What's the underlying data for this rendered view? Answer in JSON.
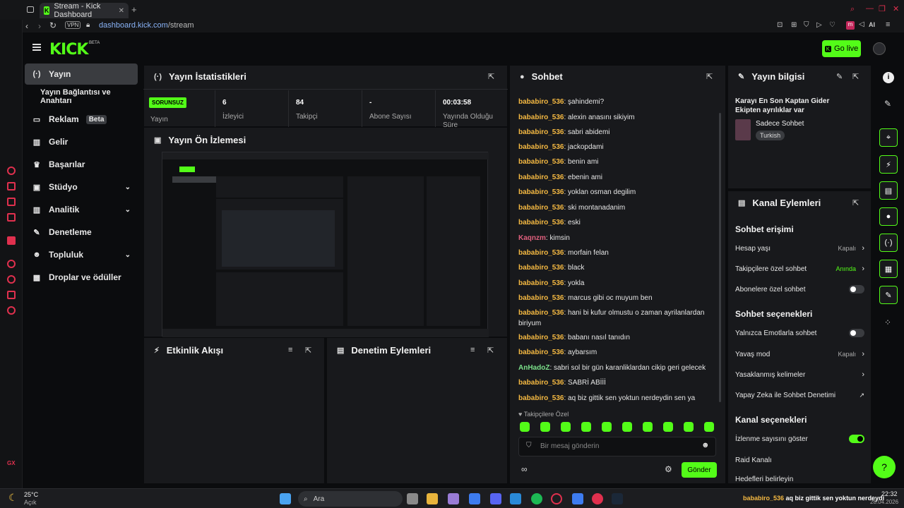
{
  "browser": {
    "tab_title": "Stream - Kick Dashboard",
    "url_host": "dashboard.kick.com",
    "url_path": "/stream",
    "ai_label": "AI",
    "vpn_label": "VPN"
  },
  "header": {
    "logo": "KICK",
    "logo_sup": "BETA",
    "go_live": "Go live"
  },
  "sidebar": {
    "items": [
      {
        "label": "Yayın",
        "icon": "stream-icon"
      },
      {
        "label": "Yayın Bağlantısı ve Anahtarı",
        "icon": ""
      },
      {
        "label": "Reklam",
        "icon": "ad-icon",
        "badge": "Beta"
      },
      {
        "label": "Gelir",
        "icon": "revenue-icon"
      },
      {
        "label": "Başarılar",
        "icon": "trophy-icon"
      },
      {
        "label": "Stüdyo",
        "icon": "studio-icon"
      },
      {
        "label": "Analitik",
        "icon": "analytics-icon"
      },
      {
        "label": "Denetleme",
        "icon": "wrench-icon"
      },
      {
        "label": "Topluluk",
        "icon": "community-icon"
      },
      {
        "label": "Droplar ve ödüller",
        "icon": "gift-icon"
      }
    ]
  },
  "stats": {
    "title": "Yayın İstatistikleri",
    "status_badge": "SORUNSUZ",
    "status_label": "Yayın",
    "viewers": "6",
    "viewers_label": "İzleyici",
    "followers": "84",
    "followers_label": "Takipçi",
    "subs": "-",
    "subs_label": "Abone Sayısı",
    "uptime": "00:03:58",
    "uptime_label": "Yayında Olduğu Süre"
  },
  "preview": {
    "title": "Yayın Ön İzlemesi"
  },
  "activity": {
    "title": "Etkinlik Akışı"
  },
  "moderation": {
    "title": "Denetim Eylemleri"
  },
  "chat": {
    "title": "Sohbet",
    "messages": [
      {
        "user": "bababiro_536",
        "text": "şahindemi?",
        "color": "#f5b942"
      },
      {
        "user": "bababiro_536",
        "text": "alexin anasını sikiyim",
        "color": "#f5b942"
      },
      {
        "user": "bababiro_536",
        "text": "sabri abidemi",
        "color": "#f5b942"
      },
      {
        "user": "bababiro_536",
        "text": "jackopdami",
        "color": "#f5b942"
      },
      {
        "user": "bababiro_536",
        "text": "benin ami",
        "color": "#f5b942"
      },
      {
        "user": "bababiro_536",
        "text": "ebenin ami",
        "color": "#f5b942"
      },
      {
        "user": "bababiro_536",
        "text": "yoklan osman degilim",
        "color": "#f5b942"
      },
      {
        "user": "bababiro_536",
        "text": "ski montanadanim",
        "color": "#f5b942"
      },
      {
        "user": "bababiro_536",
        "text": "eski",
        "color": "#f5b942"
      },
      {
        "user": "Kaqnzm",
        "text": "kimsin",
        "color": "#e0607e"
      },
      {
        "user": "bababiro_536",
        "text": "morfain felan",
        "color": "#f5b942"
      },
      {
        "user": "bababiro_536",
        "text": "black",
        "color": "#f5b942"
      },
      {
        "user": "bababiro_536",
        "text": "yokla",
        "color": "#f5b942"
      },
      {
        "user": "bababiro_536",
        "text": "marcus gibi oc muyum ben",
        "color": "#f5b942"
      },
      {
        "user": "bababiro_536",
        "text": "hani bi kufur olmustu o zaman ayrilanlardan biriyum",
        "color": "#f5b942"
      },
      {
        "user": "bababiro_536",
        "text": "babanı nasıl tanıdın",
        "color": "#f5b942"
      },
      {
        "user": "bababiro_536",
        "text": "aybarsım",
        "color": "#f5b942"
      },
      {
        "user": "AnHadoZ",
        "text": "sabri sol bir gün karanliklardan cikip geri gelecek",
        "color": "#7be08a"
      },
      {
        "user": "bababiro_536",
        "text": "SABRİ ABİİİ",
        "color": "#f5b942"
      },
      {
        "user": "bababiro_536",
        "text": "aq biz gittik sen yoktun nerdeydin sen ya",
        "color": "#f5b942"
      }
    ],
    "followers_only": "Takipçilere Özel",
    "input_placeholder": "Bir mesaj gönderin",
    "send": "Gönder"
  },
  "stream_info": {
    "title": "Yayın bilgisi",
    "stream_title": "Karayı En Son Kaptan Gider Ekipten ayrılıklar var",
    "category": "Sadece Sohbet",
    "language": "Turkish"
  },
  "channel_actions": {
    "title": "Kanal Eylemleri",
    "chat_access": "Sohbet erişimi",
    "account_age": "Hesap yaşı",
    "account_age_val": "Kapalı",
    "followers_chat": "Takipçilere özel sohbet",
    "followers_chat_val": "Anında",
    "subs_chat": "Abonelere özel sohbet",
    "chat_options": "Sohbet seçenekleri",
    "emote_only": "Yalnızca Emotlarla sohbet",
    "slow_mode": "Yavaş mod",
    "slow_mode_val": "Kapalı",
    "banned_words": "Yasaklanmış kelimeler",
    "ai_moderation": "Yapay Zeka ile Sohbet Denetimi",
    "channel_options": "Kanal seçenekleri",
    "show_viewers": "İzlenme sayısını göster",
    "raid_channel": "Raid Kanalı",
    "goals": "Hedefleri belirleyin"
  },
  "taskbar": {
    "temp": "25°C",
    "weather": "Açık",
    "search": "Ara",
    "time": "22:32",
    "date": "28.04.2026",
    "notif_user": "bababiro_536",
    "notif_text": "aq biz gittik sen yoktun nerdeydin sen ya"
  }
}
